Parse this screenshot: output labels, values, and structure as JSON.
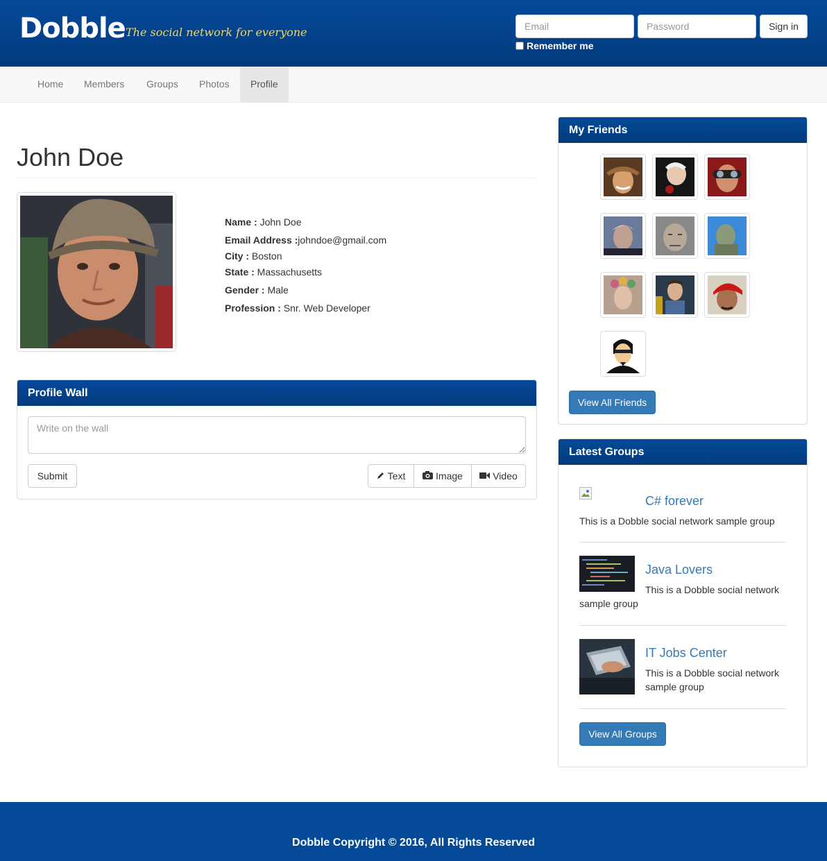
{
  "header": {
    "logo": "Dobble",
    "tagline": "The social network for everyone",
    "email_placeholder": "Email",
    "password_placeholder": "Password",
    "signin_label": "Sign in",
    "remember_label": "Remember me"
  },
  "nav": {
    "items": [
      "Home",
      "Members",
      "Groups",
      "Photos",
      "Profile"
    ],
    "active": "Profile"
  },
  "profile": {
    "title": "John Doe",
    "fields": [
      {
        "label": "Name :",
        "value": " John Doe"
      },
      {
        "label": "Email Address :",
        "value": "johndoe@gmail.com"
      },
      {
        "label": "City :",
        "value": " Boston"
      },
      {
        "label": "State :",
        "value": " Massachusetts"
      },
      {
        "label": "Gender :",
        "value": " Male"
      },
      {
        "label": "Profession :",
        "value": " Snr. Web Developer"
      }
    ]
  },
  "wall": {
    "heading": "Profile Wall",
    "placeholder": "Write on the wall",
    "submit_label": "Submit",
    "text_label": "Text",
    "image_label": "Image",
    "video_label": "Video"
  },
  "friends": {
    "heading": "My Friends",
    "view_all_label": "View All Friends"
  },
  "groups": {
    "heading": "Latest Groups",
    "items": [
      {
        "name": "C# forever",
        "desc": "This is a Dobble social network sample group"
      },
      {
        "name": "Java Lovers",
        "desc": "This is a Dobble social network sample group"
      },
      {
        "name": "IT Jobs Center",
        "desc": "This is a Dobble social network sample group"
      }
    ],
    "view_all_label": "View All Groups"
  },
  "footer": {
    "text": "Dobble Copyright © 2016, All Rights Reserved"
  },
  "colors": {
    "brand_blue": "#044a99",
    "primary_button": "#337ab7",
    "tagline_yellow": "#f0d76a"
  }
}
